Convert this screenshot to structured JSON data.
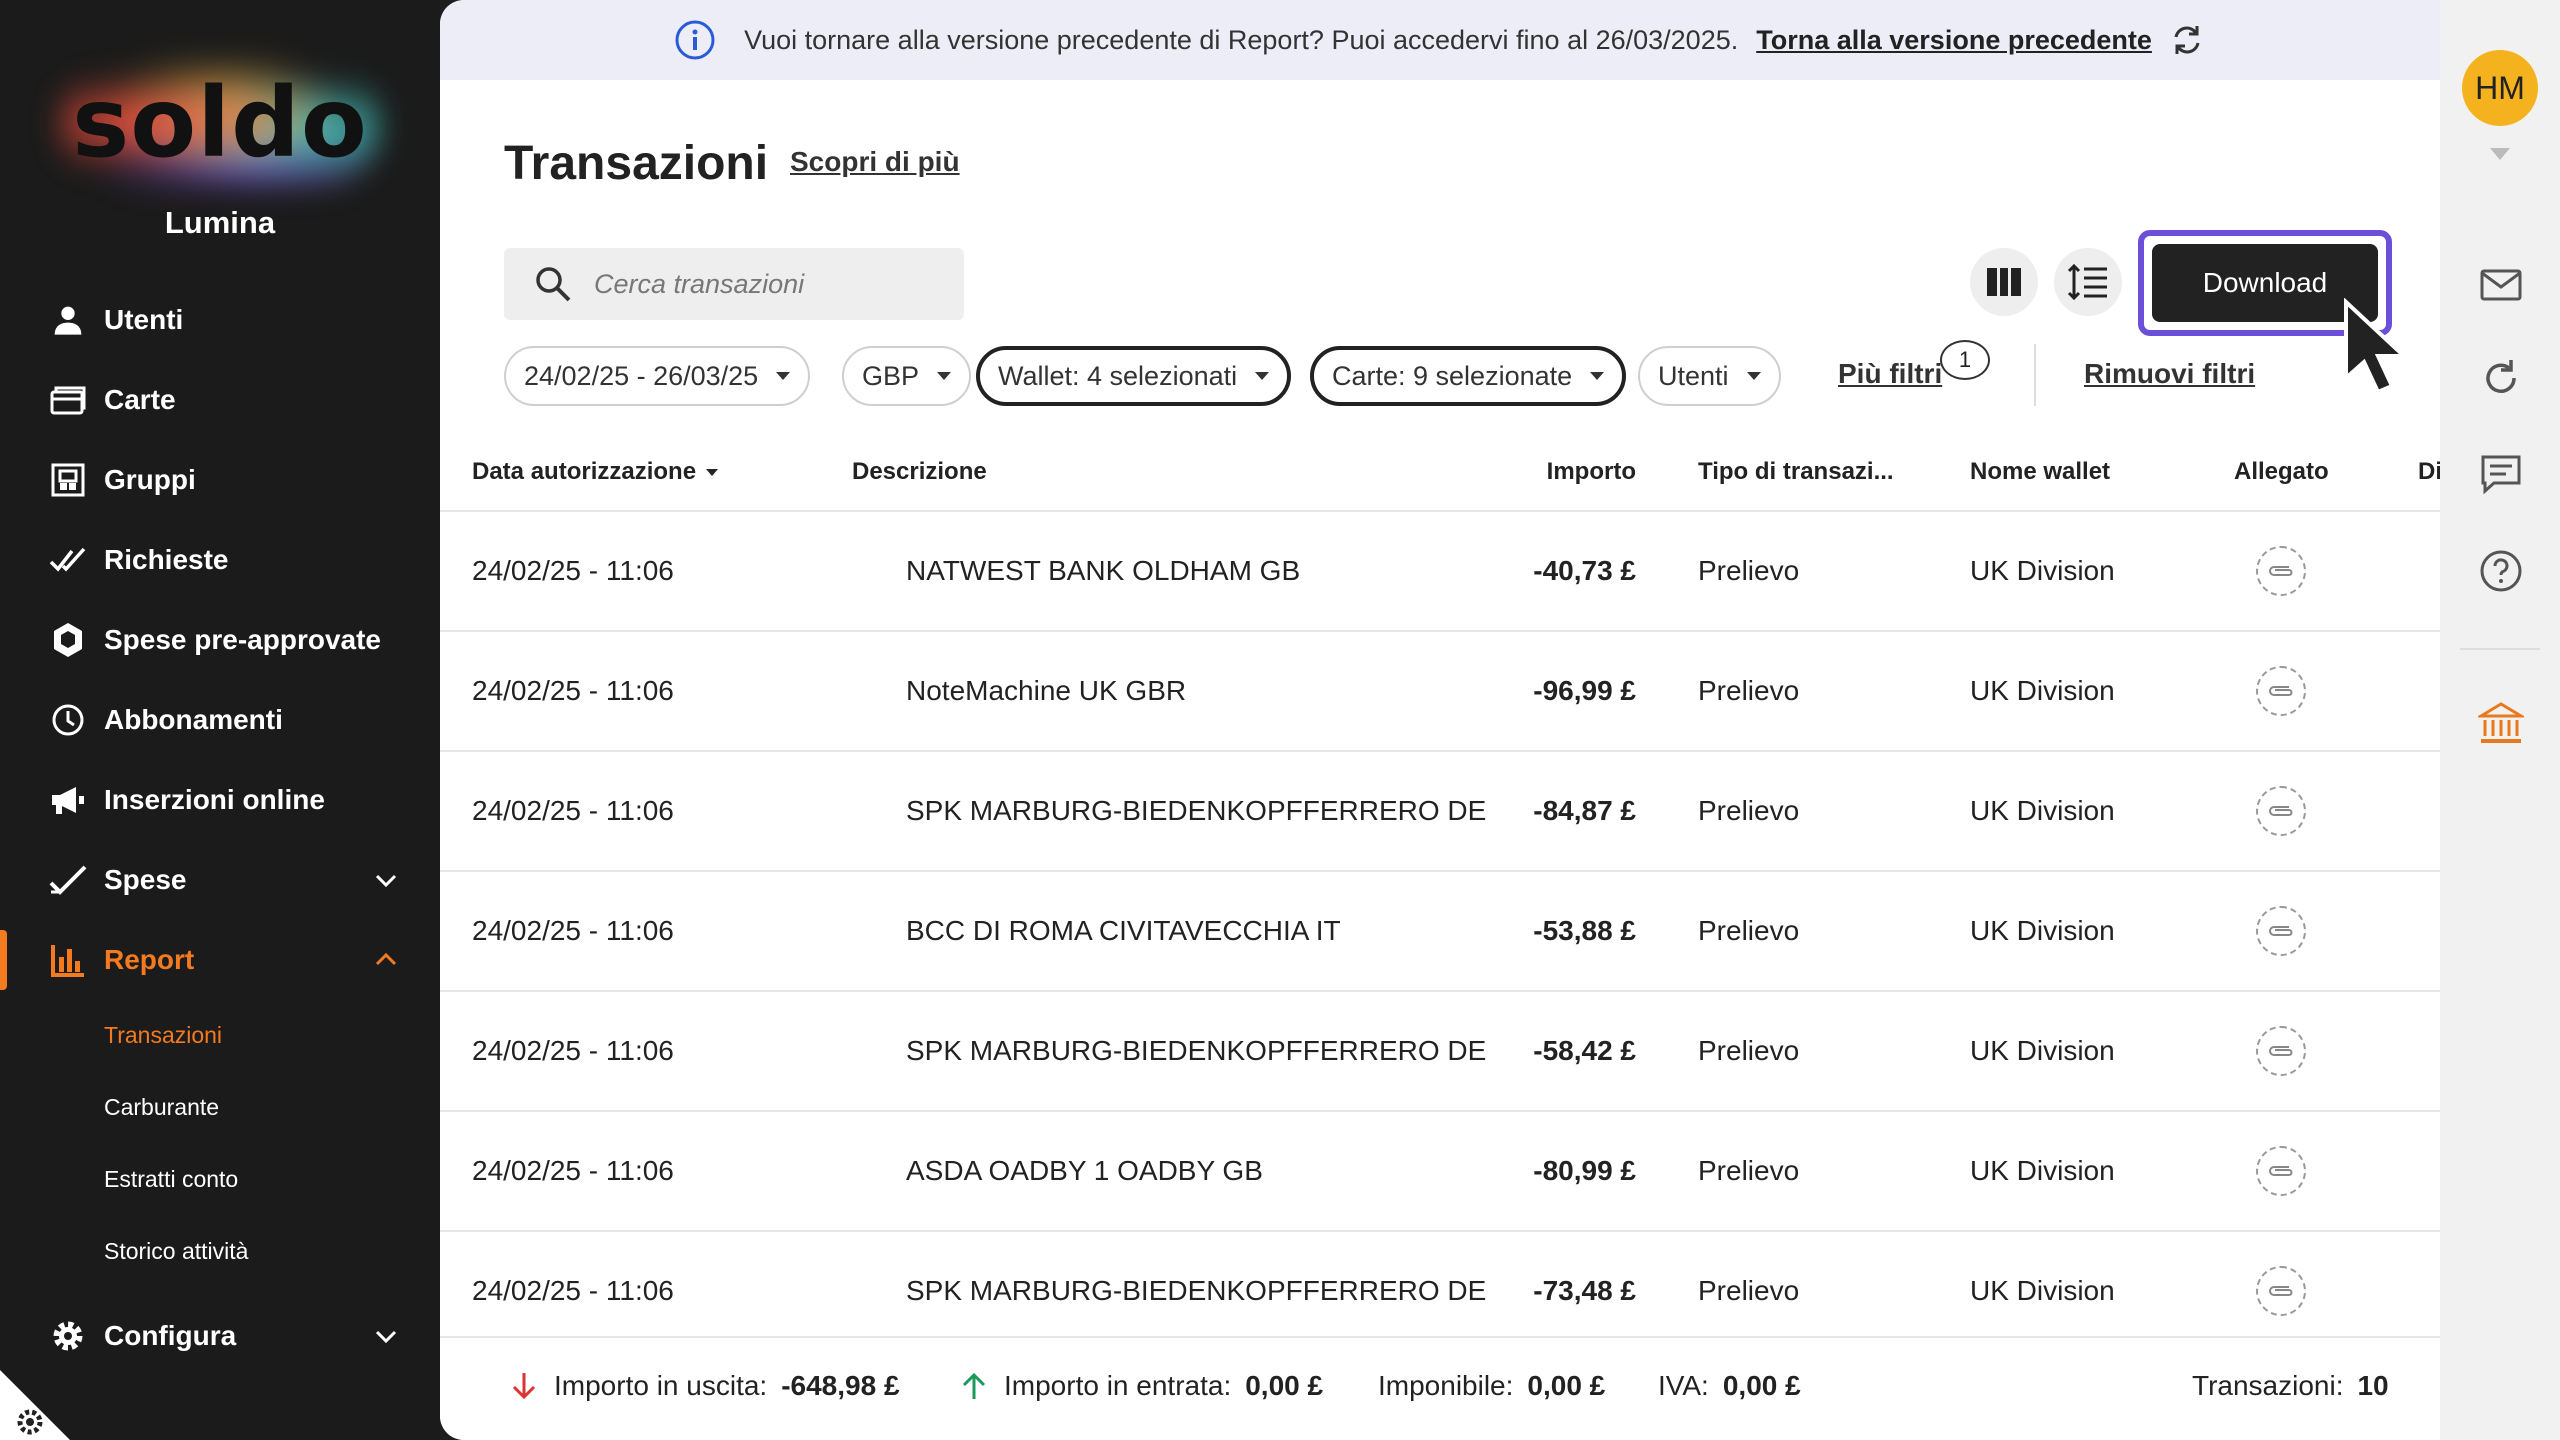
{
  "sidebar": {
    "logo": "soldo",
    "org_name": "Lumina",
    "items": [
      {
        "label": "Utenti",
        "icon": "user-icon"
      },
      {
        "label": "Carte",
        "icon": "card-icon"
      },
      {
        "label": "Gruppi",
        "icon": "groups-icon"
      },
      {
        "label": "Richieste",
        "icon": "double-check-icon"
      },
      {
        "label": "Spese pre-approvate",
        "icon": "shield-icon"
      },
      {
        "label": "Abbonamenti",
        "icon": "clock-icon"
      },
      {
        "label": "Inserzioni online",
        "icon": "megaphone-icon"
      },
      {
        "label": "Spese",
        "icon": "check-icon"
      },
      {
        "label": "Report",
        "icon": "bar-chart-icon"
      },
      {
        "label": "Configura",
        "icon": "gear-icon"
      }
    ],
    "report_subitems": [
      "Transazioni",
      "Carburante",
      "Estratti conto",
      "Storico attività"
    ],
    "active_item": "Report",
    "active_subitem": "Transazioni",
    "accent_color": "#f47a20"
  },
  "banner": {
    "text": "Vuoi tornare alla versione precedente di Report? Puoi accedervi fino al 26/03/2025.",
    "link": "Torna alla versione precedente"
  },
  "header": {
    "title": "Transazioni",
    "learn_more": "Scopri di più",
    "search_placeholder": "Cerca transazioni",
    "download_label": "Download"
  },
  "filters": {
    "date": "24/02/25 - 26/03/25",
    "currency": "GBP",
    "wallet": "Wallet: 4 selezionati",
    "cards": "Carte: 9 selezionate",
    "users": "Utenti",
    "more": "Più filtri",
    "more_count": "1",
    "clear": "Rimuovi filtri"
  },
  "table": {
    "columns": {
      "date": "Data autorizzazione",
      "description": "Descrizione",
      "amount": "Importo",
      "type": "Tipo di transazi...",
      "wallet": "Nome wallet",
      "attachment": "Allegato",
      "extra": "Di"
    },
    "rows": [
      {
        "date": "24/02/25 - 11:06",
        "description": "NATWEST BANK OLDHAM GB",
        "amount": "-40,73 £",
        "type": "Prelievo",
        "wallet": "UK Division"
      },
      {
        "date": "24/02/25 - 11:06",
        "description": "NoteMachine UK GBR",
        "amount": "-96,99 £",
        "type": "Prelievo",
        "wallet": "UK Division"
      },
      {
        "date": "24/02/25 - 11:06",
        "description": "SPK MARBURG-BIEDENKOPFFERRERO DE",
        "amount": "-84,87 £",
        "type": "Prelievo",
        "wallet": "UK Division"
      },
      {
        "date": "24/02/25 - 11:06",
        "description": "BCC DI ROMA CIVITAVECCHIA IT",
        "amount": "-53,88 £",
        "type": "Prelievo",
        "wallet": "UK Division"
      },
      {
        "date": "24/02/25 - 11:06",
        "description": "SPK MARBURG-BIEDENKOPFFERRERO DE",
        "amount": "-58,42 £",
        "type": "Prelievo",
        "wallet": "UK Division"
      },
      {
        "date": "24/02/25 - 11:06",
        "description": "ASDA OADBY 1 OADBY GB",
        "amount": "-80,99 £",
        "type": "Prelievo",
        "wallet": "UK Division"
      },
      {
        "date": "24/02/25 - 11:06",
        "description": "SPK MARBURG-BIEDENKOPFFERRERO DE",
        "amount": "-73,48 £",
        "type": "Prelievo",
        "wallet": "UK Division"
      }
    ]
  },
  "footer": {
    "out_label": "Importo in uscita:",
    "out_value": "-648,98 £",
    "in_label": "Importo in entrata:",
    "in_value": "0,00 £",
    "taxable_label": "Imponibile:",
    "taxable_value": "0,00 £",
    "vat_label": "IVA:",
    "vat_value": "0,00 £",
    "count_label": "Transazioni:",
    "count_value": "10"
  },
  "rail": {
    "avatar": "HM",
    "icons": [
      "mail-icon",
      "refresh-icon",
      "chat-icon",
      "help-icon",
      "bank-icon"
    ]
  }
}
